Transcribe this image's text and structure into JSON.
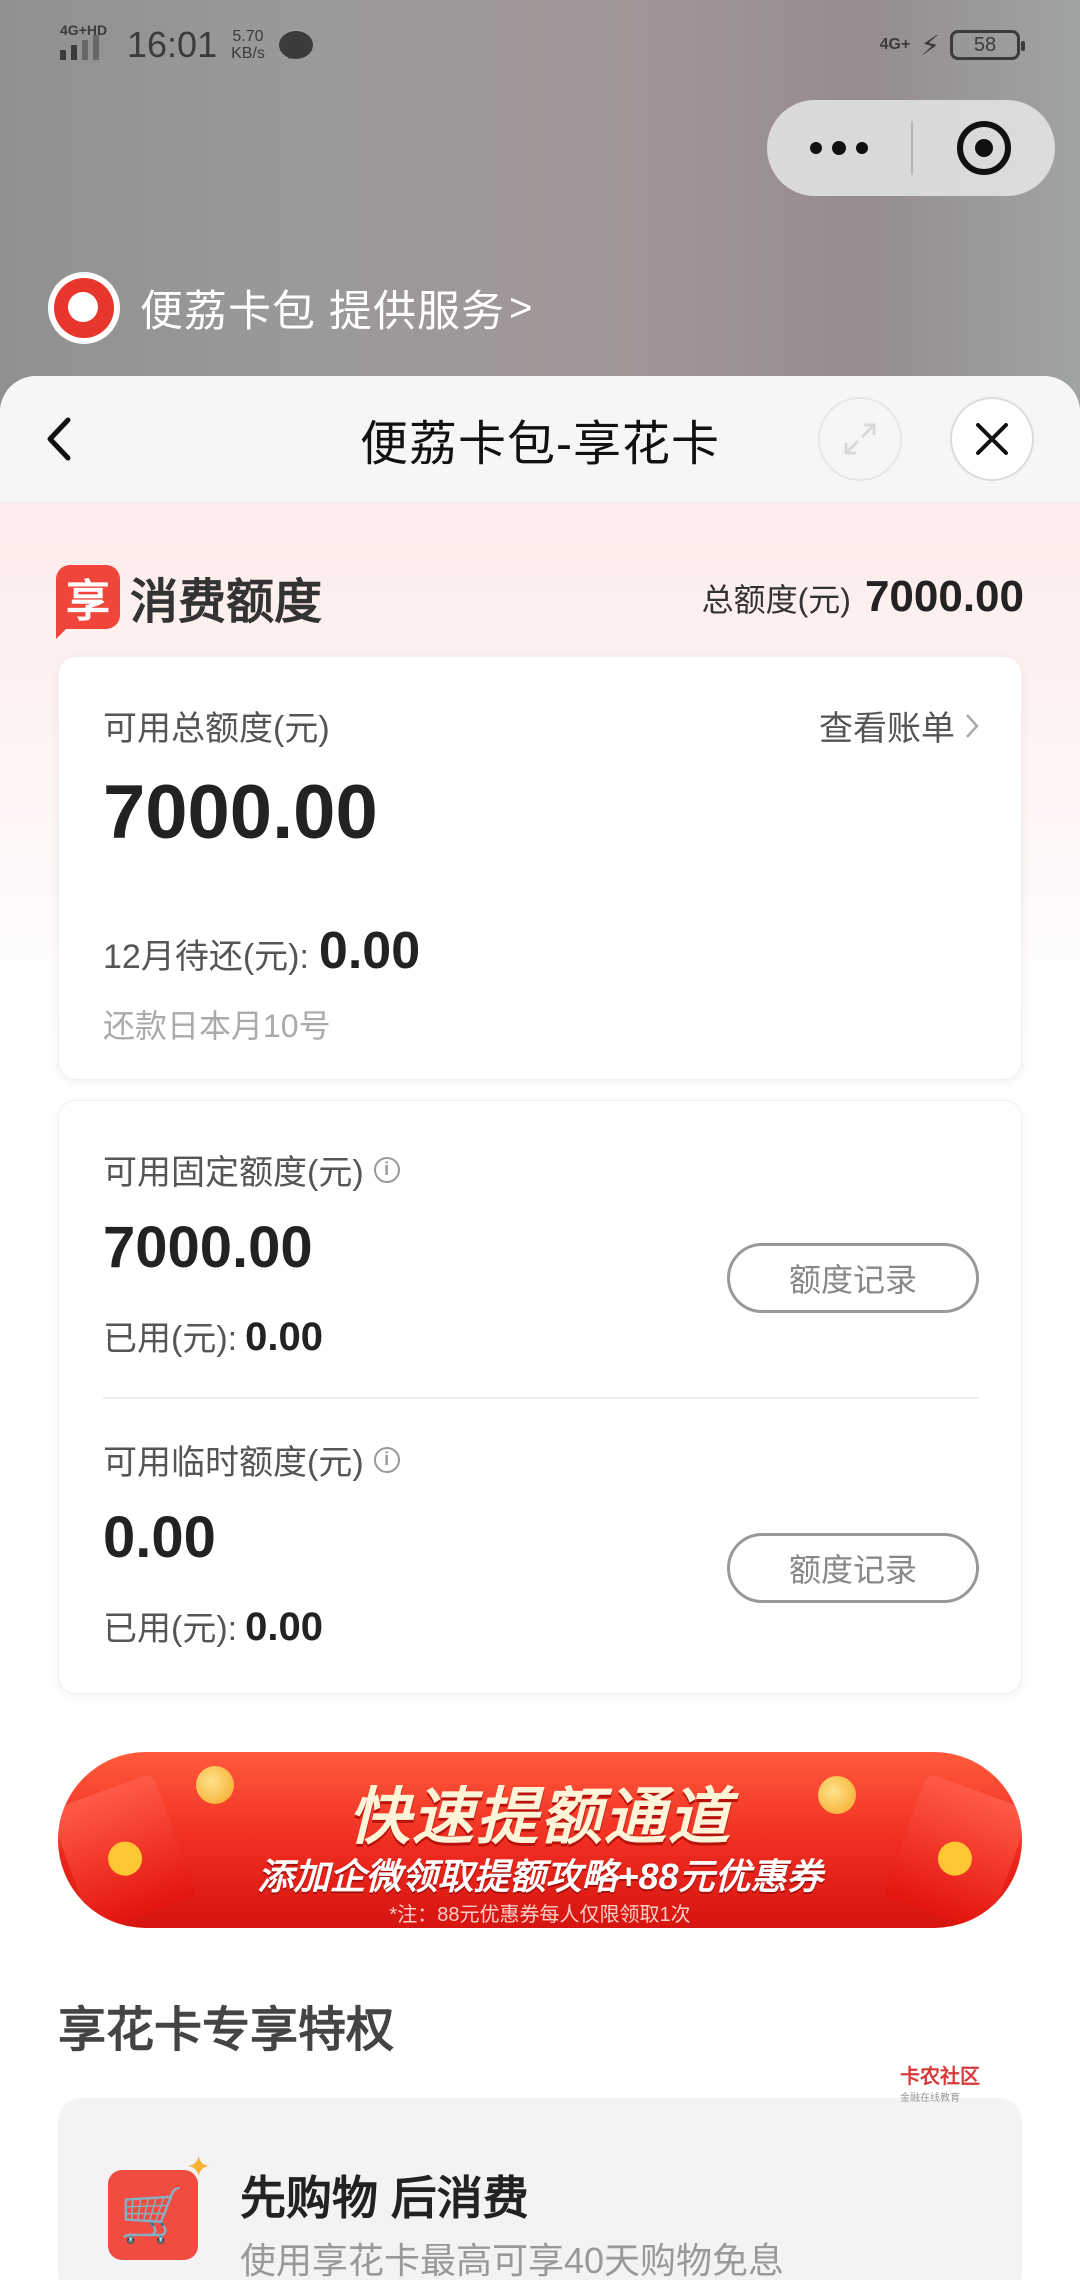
{
  "status_bar": {
    "network": "4G+HD",
    "time": "16:01",
    "speed_value": "5.70",
    "speed_unit": "KB/s",
    "network_right": "4G+",
    "battery": "58"
  },
  "provider": {
    "text": "便荔卡包 提供服务",
    "chevron": ">"
  },
  "nav": {
    "title": "便荔卡包-享花卡"
  },
  "quota": {
    "badge": "享",
    "title": "消费额度",
    "total_label": "总额度(元)",
    "total_value": "7000.00"
  },
  "available_card": {
    "label": "可用总额度(元)",
    "bill_link": "查看账单",
    "value": "7000.00",
    "due_label": "12月待还(元):",
    "due_value": "0.00",
    "repay_note": "还款日本月10号"
  },
  "fixed": {
    "label": "可用固定额度(元)",
    "value": "7000.00",
    "used_label": "已用(元):",
    "used_value": "0.00",
    "record_button": "额度记录"
  },
  "temporary": {
    "label": "可用临时额度(元)",
    "value": "0.00",
    "used_label": "已用(元):",
    "used_value": "0.00",
    "record_button": "额度记录"
  },
  "banner": {
    "title": "快速提额通道",
    "subtitle": "添加企微领取提额攻略+88元优惠券",
    "note": "*注：88元优惠券每人仅限领取1次"
  },
  "privileges": {
    "title": "享花卡专享特权",
    "items": [
      {
        "name": "先购物 后消费",
        "desc": "使用享花卡最高可享40天购物免息"
      }
    ]
  },
  "watermark": {
    "name": "卡农社区",
    "sub": "金融在线教育"
  },
  "colors": {
    "accent": "#f0453b",
    "banner_red": "#ee2b1f"
  }
}
